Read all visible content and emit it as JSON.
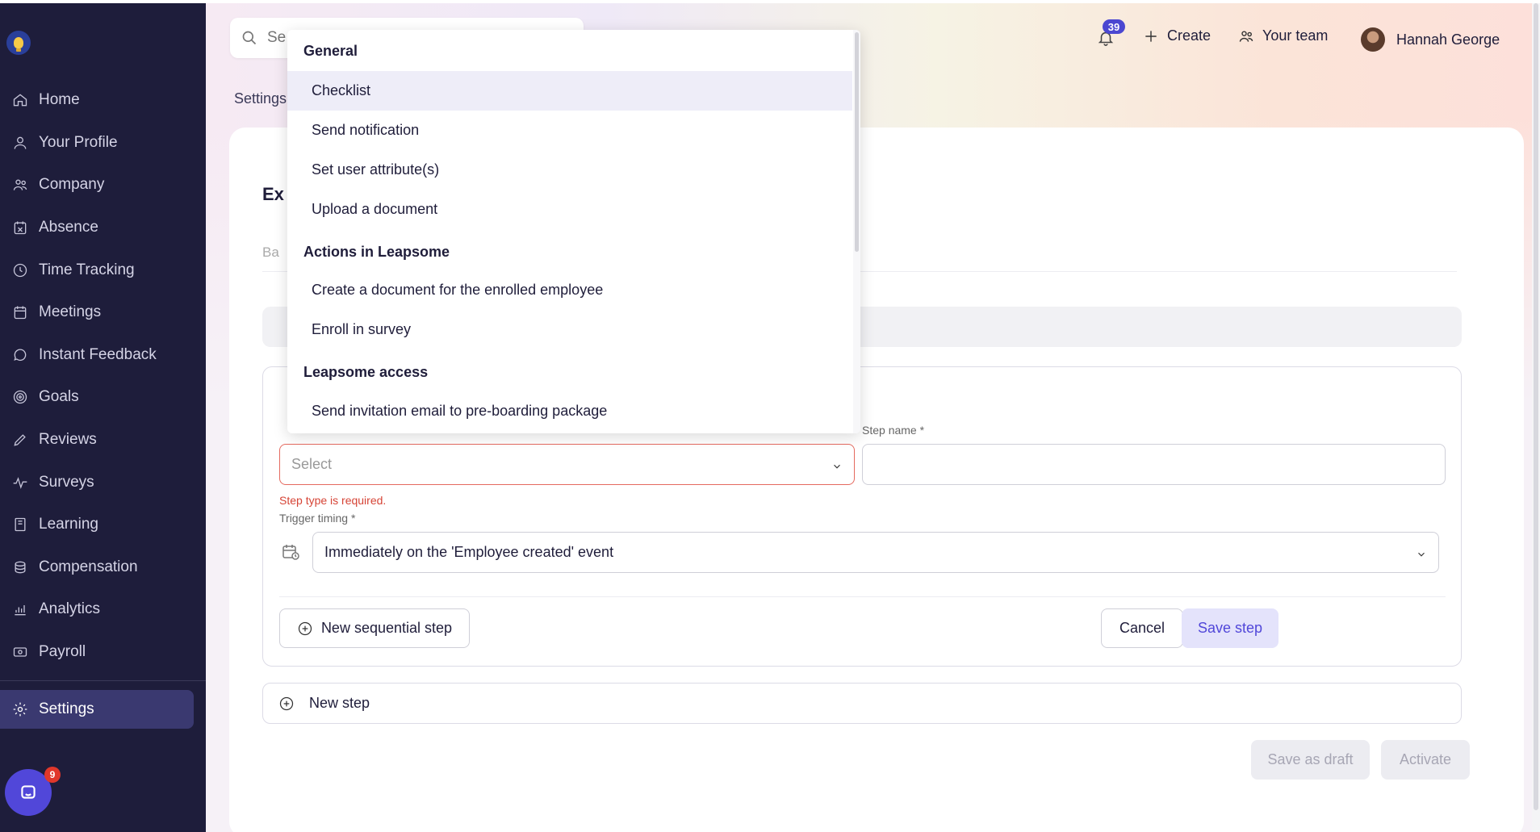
{
  "sidebar": {
    "items": [
      {
        "label": "Home",
        "icon": "home-icon"
      },
      {
        "label": "Your Profile",
        "icon": "user-icon"
      },
      {
        "label": "Company",
        "icon": "people-icon"
      },
      {
        "label": "Absence",
        "icon": "calendar-x-icon"
      },
      {
        "label": "Time Tracking",
        "icon": "clock-icon"
      },
      {
        "label": "Meetings",
        "icon": "calendar-icon"
      },
      {
        "label": "Instant Feedback",
        "icon": "chat-bubble-icon"
      },
      {
        "label": "Goals",
        "icon": "target-icon"
      },
      {
        "label": "Reviews",
        "icon": "pencil-icon"
      },
      {
        "label": "Surveys",
        "icon": "pulse-icon"
      },
      {
        "label": "Learning",
        "icon": "book-icon"
      },
      {
        "label": "Compensation",
        "icon": "coins-icon"
      },
      {
        "label": "Analytics",
        "icon": "chart-icon"
      },
      {
        "label": "Payroll",
        "icon": "cash-icon"
      }
    ],
    "settings_label": "Settings",
    "chat_badge": "9"
  },
  "topbar": {
    "search_placeholder": "Se",
    "notifications_count": "39",
    "create_label": "Create",
    "team_label": "Your team",
    "user_name": "Hannah George"
  },
  "breadcrumb": "Settings",
  "card": {
    "title_partial": "Ex",
    "tab_partial": "Ba"
  },
  "step_form": {
    "step_type_placeholder": "Select",
    "step_name_label": "Step name *",
    "step_type_error": "Step type is required.",
    "trigger_label": "Trigger timing *",
    "trigger_value": "Immediately on the 'Employee created' event",
    "new_sequential_label": "New sequential step",
    "cancel_label": "Cancel",
    "save_label": "Save step"
  },
  "new_step_label": "New step",
  "footer_buttons": {
    "draft_label": "Save as draft",
    "activate_label": "Activate"
  },
  "dropdown": {
    "groups": [
      {
        "heading": "General",
        "items": [
          "Checklist",
          "Send notification",
          "Set user attribute(s)",
          "Upload a document"
        ]
      },
      {
        "heading": "Actions in Leapsome",
        "items": [
          "Create a document for the enrolled employee",
          "Enroll in survey"
        ]
      },
      {
        "heading": "Leapsome access",
        "items": [
          "Send invitation email to pre-boarding package"
        ]
      }
    ],
    "highlighted": "Checklist"
  },
  "colors": {
    "sidebar_bg": "#1e1d3b",
    "accent": "#5147d9",
    "error": "#d64436"
  }
}
